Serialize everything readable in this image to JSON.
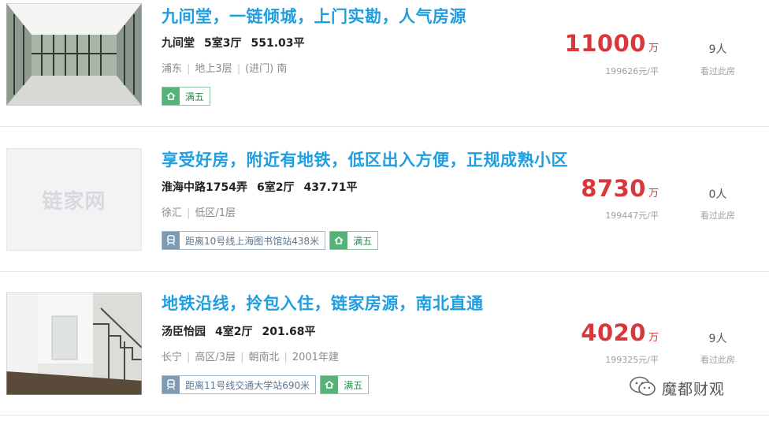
{
  "listings": [
    {
      "title": "九间堂，一链倾城，上门实勘，人气房源",
      "community": "九间堂",
      "layout": "5室3厅",
      "area": "551.03平",
      "meta": [
        "浦东",
        "地上3层",
        "(进门) 南"
      ],
      "subway": null,
      "tag": "满五",
      "price": "11000",
      "price_unit": "万",
      "unit_price": "199626元/平",
      "views": "9人",
      "views_label": "看过此房",
      "thumb": "photo-sunroom"
    },
    {
      "title": "享受好房，附近有地铁，低区出入方便，正规成熟小区",
      "community": "淮海中路1754弄",
      "layout": "6室2厅",
      "area": "437.71平",
      "meta": [
        "徐汇",
        "低区/1层"
      ],
      "subway": "距离10号线上海图书馆站438米",
      "tag": "满五",
      "price": "8730",
      "price_unit": "万",
      "unit_price": "199447元/平",
      "views": "0人",
      "views_label": "看过此房",
      "thumb": "placeholder",
      "placeholder_text": "链家网"
    },
    {
      "title": "地铁沿线，拎包入住，链家房源，南北直通",
      "community": "汤臣怡园",
      "layout": "4室2厅",
      "area": "201.68平",
      "meta": [
        "长宁",
        "高区/3层",
        "朝南北",
        "2001年建"
      ],
      "subway": "距离11号线交通大学站690米",
      "tag": "满五",
      "price": "4020",
      "price_unit": "万",
      "unit_price": "199325元/平",
      "views": "9人",
      "views_label": "看过此房",
      "thumb": "photo-stairs"
    }
  ],
  "watermark": {
    "text": "魔都财观",
    "icon": "wechat-icon"
  },
  "colors": {
    "title": "#1f9ee0",
    "price": "#d8383b",
    "tag_green": "#57b279",
    "tag_subway": "#7d9bb5"
  }
}
